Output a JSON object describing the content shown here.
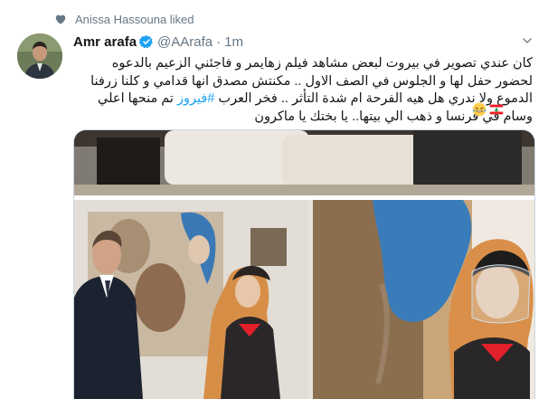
{
  "social_context": {
    "icon": "heart-icon",
    "text": "Anissa Hassouna liked"
  },
  "tweet": {
    "author": {
      "name": "Amr arafa",
      "handle": "@AArafa",
      "verified_icon": "verified-badge-icon",
      "avatar_icon": "avatar-photo"
    },
    "separator": "·",
    "time": "1m",
    "text_before_hashtag": "كان عندي تصوير في بيروت لبعض مشاهد فيلم زهايمر و فاجئني الزعيم بالدعوه لحضور حفل لها و الجلوس في الصف الاول .. مكنتش مصدق انها قدامي و كلنا زرفنا الدموع ولا ندري هل هيه الفرحة ام شدة التأثر .. فخر العرب ",
    "hashtag": "#فيروز",
    "text_after_hashtag": " تم منحها اعلي وسام في فرنسا و ذهب  الي بيتها.. يا بختك يا ماكرون",
    "emojis": [
      "laughing-tears-emoji",
      "lebanon-flag-emoji"
    ],
    "menu_icon": "chevron-down-icon",
    "media_image": "collage-photo"
  },
  "colors": {
    "link": "#1da1f2",
    "secondary_text": "#657786",
    "border": "#ccd6dd"
  }
}
